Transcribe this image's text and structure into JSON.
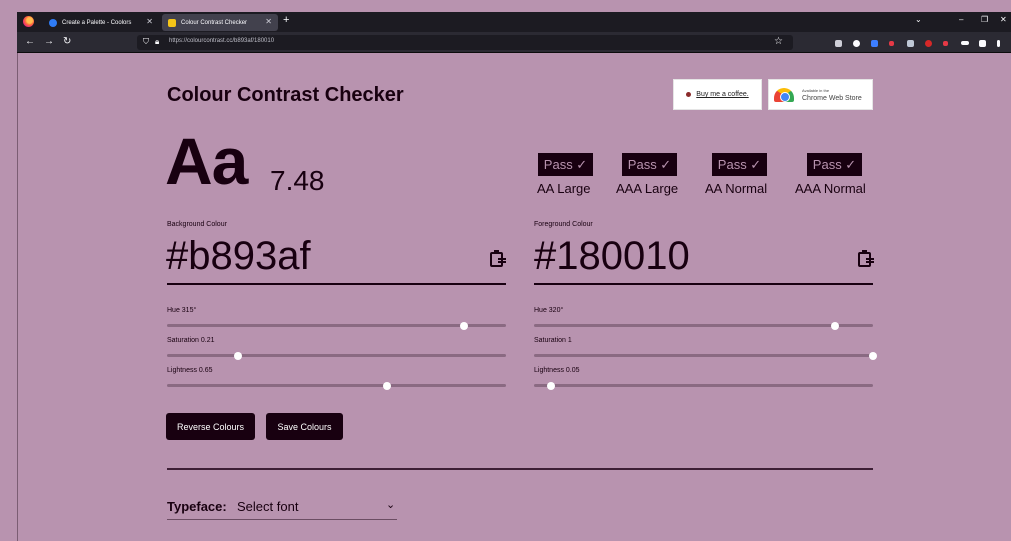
{
  "browser": {
    "tabs": [
      {
        "label": "Create a Palette - Coolors",
        "active": false
      },
      {
        "label": "Colour Contrast Checker",
        "active": true
      }
    ],
    "new_tab": "+",
    "url": "https://colourcontrast.cc/b893af/180010"
  },
  "page": {
    "title": "Colour Contrast Checker",
    "buy_coffee": "Buy me a coffee.",
    "cws_small": "Available in the",
    "cws_big": "Chrome Web Store"
  },
  "preview": {
    "sample": "Aa",
    "ratio": "7.48"
  },
  "checks": [
    {
      "badge": "Pass ✓",
      "label": "AA Large"
    },
    {
      "badge": "Pass ✓",
      "label": "AAA Large"
    },
    {
      "badge": "Pass ✓",
      "label": "AA Normal"
    },
    {
      "badge": "Pass ✓",
      "label": "AAA Normal"
    }
  ],
  "background": {
    "label": "Background Colour",
    "hex": "#b893af",
    "hue_label": "Hue 315°",
    "hue": 315,
    "saturation_label": "Saturation 0.21",
    "saturation": 0.21,
    "lightness_label": "Lightness 0.65",
    "lightness": 0.65
  },
  "foreground": {
    "label": "Foreground Colour",
    "hex": "#180010",
    "hue_label": "Hue 320°",
    "hue": 320,
    "saturation_label": "Saturation 1",
    "saturation": 1,
    "lightness_label": "Lightness 0.05",
    "lightness": 0.05
  },
  "actions": {
    "reverse": "Reverse Colours",
    "save": "Save Colours"
  },
  "typeface": {
    "label": "Typeface:",
    "value": "Select font"
  },
  "colors": {
    "page_bg": "#b893af",
    "text": "#180010",
    "chrome_dark": "#1c1b22",
    "chrome": "#2b2a33"
  }
}
